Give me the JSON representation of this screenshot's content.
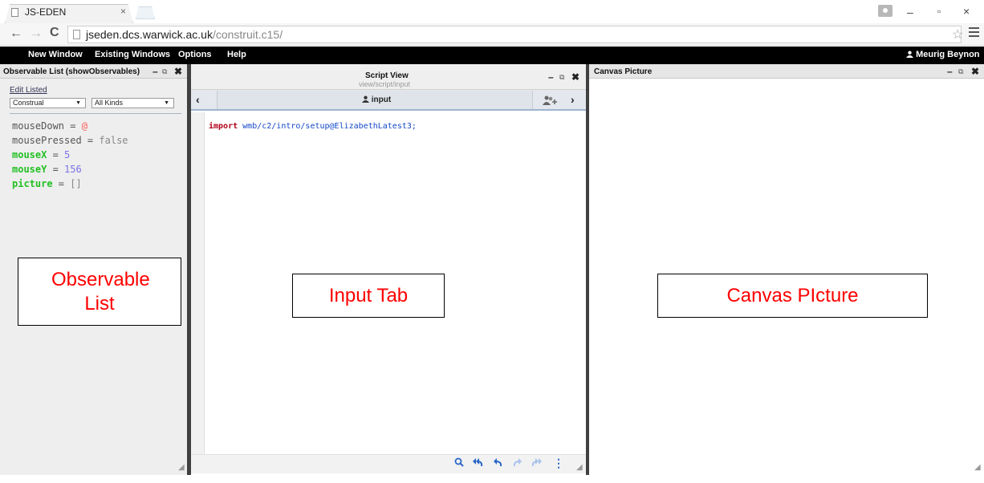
{
  "browser": {
    "tab_title": "JS-EDEN",
    "tab_close": "×",
    "url_host": "jseden.dcs.warwick.ac.uk",
    "url_path": "/construit.c15/",
    "win_min": "–",
    "win_max": "▫",
    "win_close": "×"
  },
  "menubar": {
    "items": [
      "New Window",
      "Existing Windows",
      "Options",
      "Help"
    ],
    "user": "Meurig Beynon"
  },
  "observable_panel": {
    "title": "Observable List (showObservables)",
    "edit_listed": "Edit Listed",
    "filter_select": "Construal",
    "kind_select": "All Kinds",
    "observables": [
      {
        "name": "mouseDown",
        "value": "@"
      },
      {
        "name": "mousePressed",
        "value": "false"
      },
      {
        "name": "mouseX",
        "value": "5"
      },
      {
        "name": "mouseY",
        "value": "156"
      },
      {
        "name": "picture",
        "value": "[]"
      }
    ]
  },
  "script_panel": {
    "title": "Script View",
    "subtitle": "view/script/input",
    "tab_label": "input",
    "code_keyword": "import",
    "code_path": "wmb/c2/intro/setup@ElizabethLatest3;"
  },
  "canvas_panel": {
    "title": "Canvas Picture"
  },
  "annotations": {
    "observable_list": "Observable List",
    "input_tab": "Input Tab",
    "canvas_picture": "Canvas PIcture"
  },
  "colors": {
    "menubar_bg": "#000000",
    "annotation_text": "#ff0000",
    "observable_green": "#22c022",
    "value_blue": "#7a72e8",
    "keyword_red": "#b0001a",
    "path_blue": "#1448c8",
    "toolbar_blue": "#2a66c7"
  },
  "icons": {
    "tab_page": "page-icon",
    "back": "arrow-left-icon",
    "forward": "arrow-right-icon",
    "reload": "reload-icon",
    "star": "star-icon",
    "menu": "hamburger-menu-icon",
    "user": "user-icon",
    "minimize": "minimize-icon",
    "popout": "popout-icon",
    "close": "close-icon",
    "search": "search-icon",
    "undo_all": "undo-all-icon",
    "undo": "undo-icon",
    "redo": "redo-icon",
    "redo_all": "redo-all-icon",
    "more": "more-vertical-icon",
    "add_agent": "add-user-icon"
  }
}
